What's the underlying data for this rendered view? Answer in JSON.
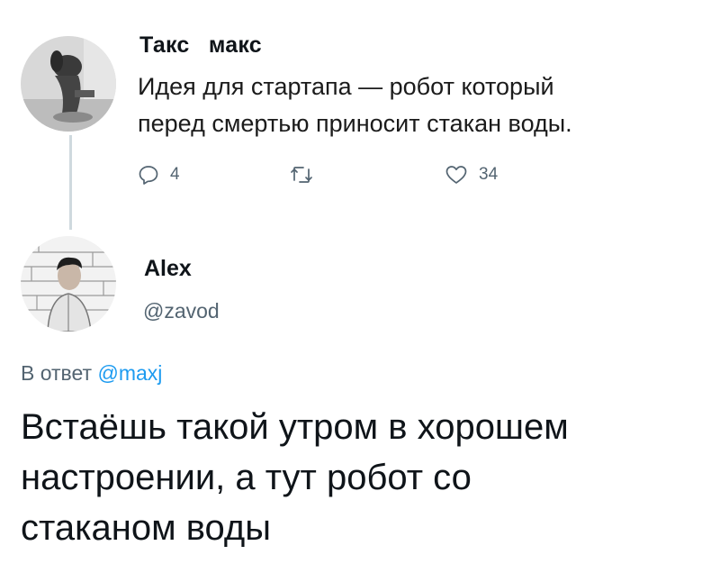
{
  "colors": {
    "background": "#ffffff",
    "text": "#0f1419",
    "secondary_text": "#536471",
    "link": "#1d9bf0",
    "thread_line": "#cfd9de"
  },
  "original_tweet": {
    "author_name": "Такс   макс",
    "avatar_icon": "dog-avatar",
    "text_lines": [
      "Идея для стартапа — робот который",
      "перед смертью приносит стакан воды."
    ],
    "actions": {
      "reply": {
        "icon": "reply-icon",
        "count": "4"
      },
      "retweet": {
        "icon": "retweet-icon",
        "count": ""
      },
      "like": {
        "icon": "heart-icon",
        "count": "34"
      }
    }
  },
  "reply_tweet": {
    "author_name": "Alex",
    "handle": "@zavod",
    "avatar_icon": "person-avatar",
    "reply_to_prefix": "В ответ",
    "reply_to_mention": "@maxj",
    "text_lines": [
      "Встаёшь такой утром в хорошем",
      "настроении, а тут робот со",
      "стаканом воды"
    ]
  }
}
